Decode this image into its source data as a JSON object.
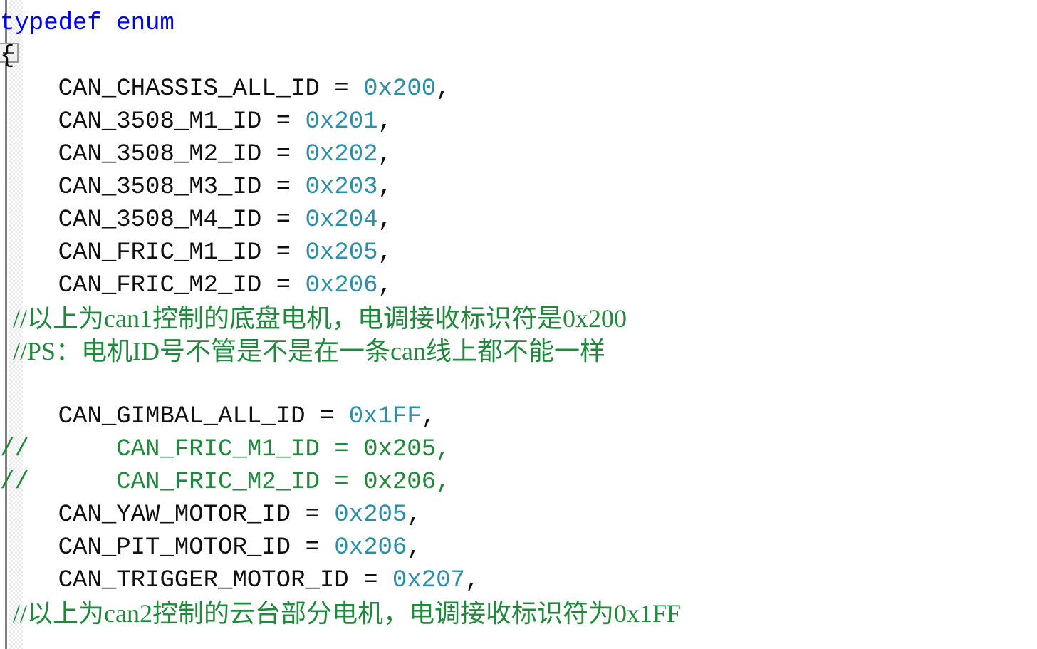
{
  "editor": {
    "app": "code-editor",
    "language": "C",
    "background_color": "#ffffff",
    "gutter": {
      "indicator_color": "#808080",
      "collapse_box_label": "−",
      "collapse_box_state": "expanded"
    },
    "syntax_colors": {
      "keyword": "#0000ff",
      "identifier": "#101010",
      "number": "#2b8fa8",
      "comment": "#1f8a3c",
      "punctuation": "#101010"
    }
  },
  "code": {
    "line_00_partial": "",
    "line_01": {
      "keyword": "typedef enum"
    },
    "line_02": {
      "brace": "{"
    },
    "line_03": {
      "indent": "    ",
      "name": "CAN_CHASSIS_ALL_ID",
      "op": " = ",
      "value": "0x200",
      "comma": ","
    },
    "line_04": {
      "indent": "    ",
      "name": "CAN_3508_M1_ID",
      "op": " = ",
      "value": "0x201",
      "comma": ","
    },
    "line_05": {
      "indent": "    ",
      "name": "CAN_3508_M2_ID",
      "op": " = ",
      "value": "0x202",
      "comma": ","
    },
    "line_06": {
      "indent": "    ",
      "name": "CAN_3508_M3_ID",
      "op": " = ",
      "value": "0x203",
      "comma": ","
    },
    "line_07": {
      "indent": "    ",
      "name": "CAN_3508_M4_ID",
      "op": " = ",
      "value": "0x204",
      "comma": ","
    },
    "line_08": {
      "indent": "    ",
      "name": "CAN_FRIC_M1_ID",
      "op": " = ",
      "value": "0x205",
      "comma": ","
    },
    "line_09": {
      "indent": "    ",
      "name": "CAN_FRIC_M2_ID",
      "op": " = ",
      "value": "0x206",
      "comma": ","
    },
    "line_10_comment": "  //以上为can1控制的底盘电机，电调接收标识符是0x200",
    "line_11_comment": "  //PS：电机ID号不管是不是在一条can线上都不能一样",
    "line_12_blank": "",
    "line_13": {
      "indent": "    ",
      "name": "CAN_GIMBAL_ALL_ID",
      "op": " = ",
      "value": "0x1FF",
      "comma": ","
    },
    "line_14_commented": "//      CAN_FRIC_M1_ID = 0x205,",
    "line_15_commented": "//      CAN_FRIC_M2_ID = 0x206,",
    "line_16": {
      "indent": "    ",
      "name": "CAN_YAW_MOTOR_ID",
      "op": " = ",
      "value": "0x205",
      "comma": ","
    },
    "line_17": {
      "indent": "    ",
      "name": "CAN_PIT_MOTOR_ID",
      "op": " = ",
      "value": "0x206",
      "comma": ","
    },
    "line_18": {
      "indent": "    ",
      "name": "CAN_TRIGGER_MOTOR_ID",
      "op": " = ",
      "value": "0x207",
      "comma": ","
    },
    "line_19_comment": "  //以上为can2控制的云台部分电机，电调接收标识符为0x1FF"
  }
}
